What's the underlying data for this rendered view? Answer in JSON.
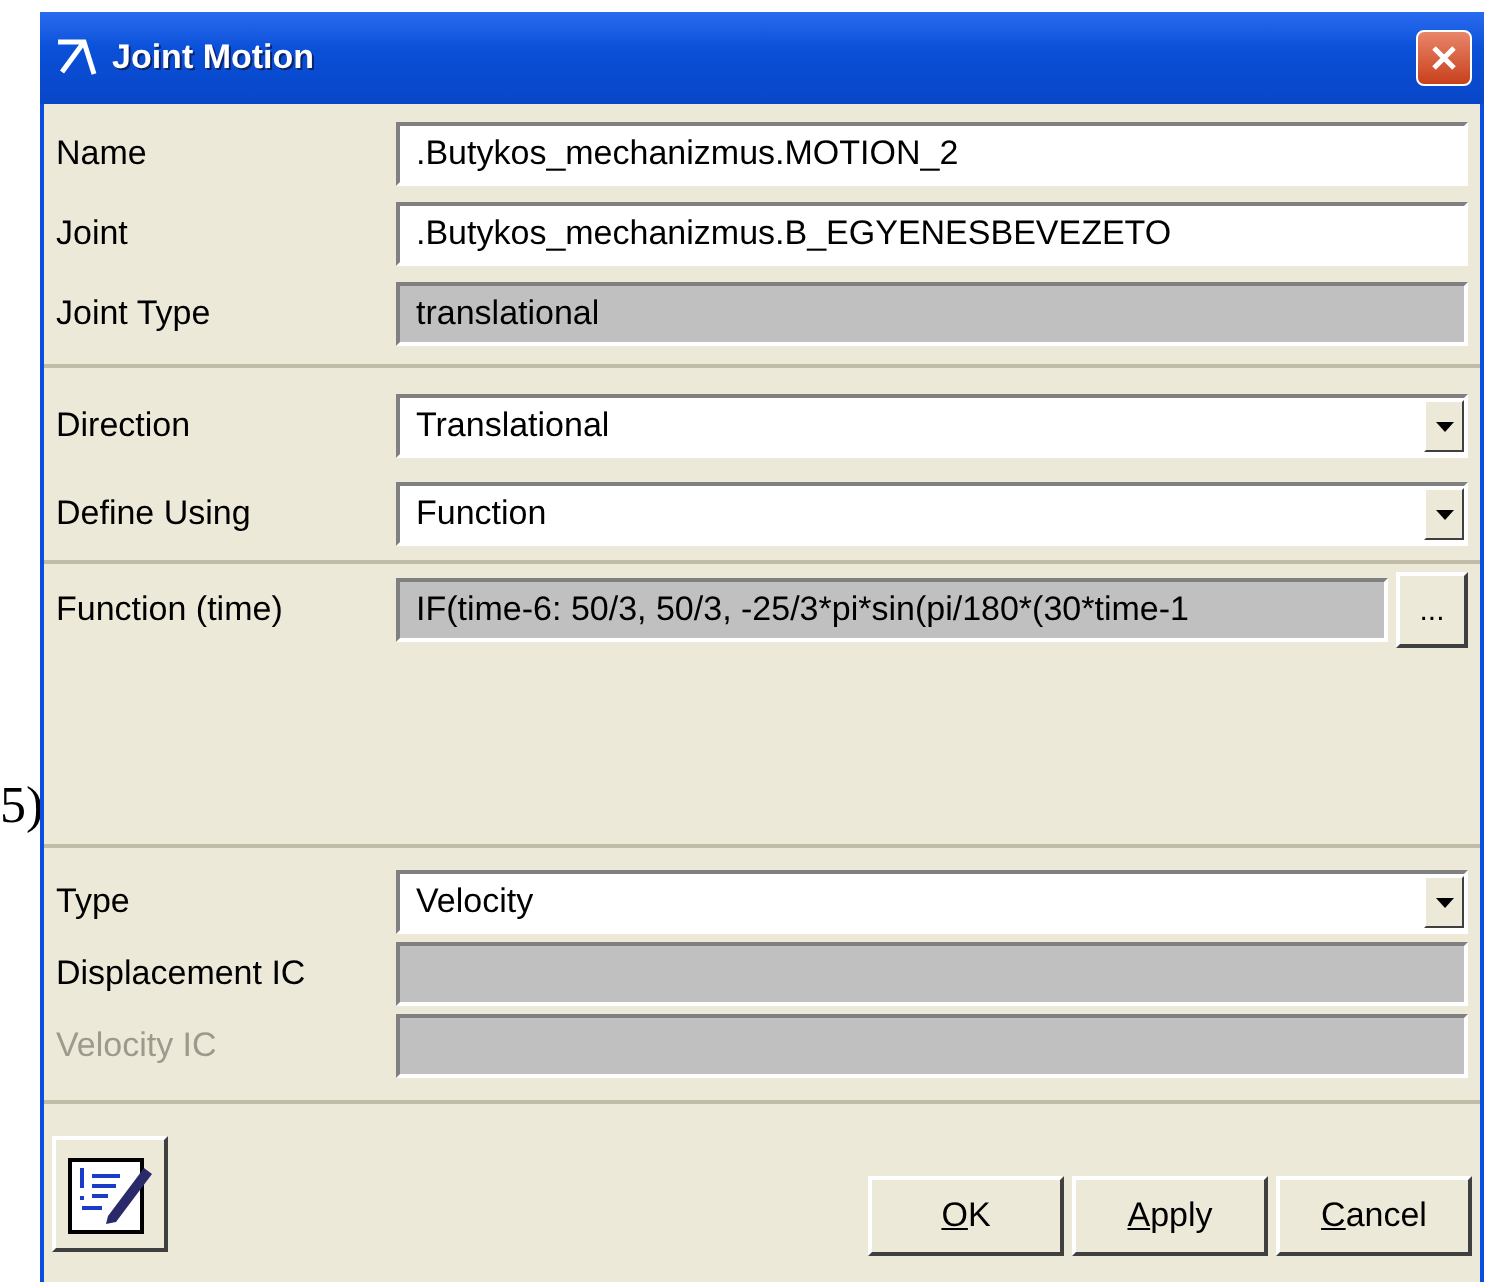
{
  "background": {
    "text": "5)"
  },
  "window": {
    "title": "Joint Motion"
  },
  "sections": [
    {
      "rows": [
        {
          "label": "Name",
          "kind": "text",
          "value": ".Butykos_mechanizmus.MOTION_2",
          "disabled": false
        },
        {
          "label": "Joint",
          "kind": "text",
          "value": ".Butykos_mechanizmus.B_EGYENESBEVEZETO",
          "disabled": false
        },
        {
          "label": "Joint Type",
          "kind": "readonly",
          "value": "translational",
          "disabled": false
        }
      ]
    },
    {
      "rows": [
        {
          "label": "Direction",
          "kind": "dropdown",
          "value": "Translational",
          "disabled": false
        },
        {
          "label": "Define Using",
          "kind": "dropdown",
          "value": "Function",
          "disabled": false
        }
      ]
    },
    {
      "rows": [
        {
          "label": "Function (time)",
          "kind": "function",
          "value": "IF(time-6: 50/3, 50/3, -25/3*pi*sin(pi/180*(30*time-1",
          "button": "...",
          "disabled": false
        }
      ]
    },
    {
      "rows": [
        {
          "label": "Type",
          "kind": "dropdown",
          "value": "Velocity",
          "disabled": false
        },
        {
          "label": "Displacement IC",
          "kind": "readonly",
          "disabled": false
        },
        {
          "label": "Velocity IC",
          "kind": "readonly",
          "disabled": true
        }
      ]
    }
  ],
  "buttons": [
    {
      "label": "OK"
    },
    {
      "label": "Apply"
    },
    {
      "label": "Cancel"
    }
  ]
}
